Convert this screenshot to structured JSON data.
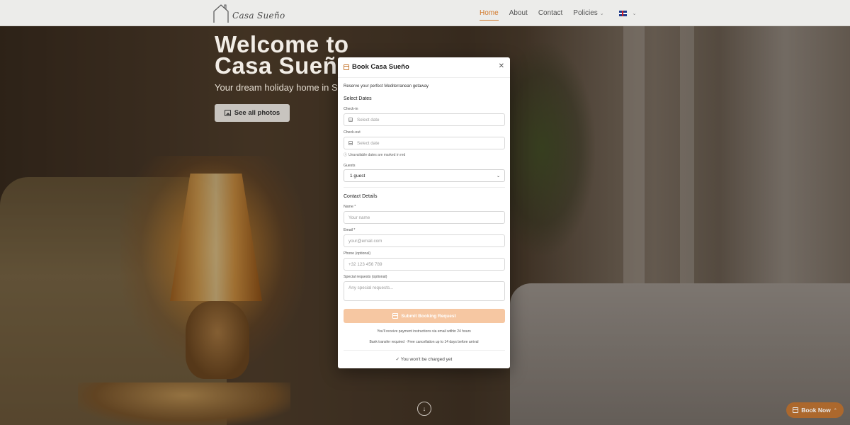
{
  "brand": {
    "logo_text": "Casa Sueño"
  },
  "nav": {
    "items": [
      {
        "label": "Home",
        "active": true
      },
      {
        "label": "About",
        "active": false
      },
      {
        "label": "Contact",
        "active": false
      },
      {
        "label": "Policies",
        "active": false
      }
    ],
    "language_icon": "uk-flag-icon",
    "accent_color": "#d27a2c"
  },
  "hero": {
    "title_line1": "Welcome to",
    "title_line2": "Casa Sueño",
    "subtitle": "Your dream holiday home in Sp",
    "photos_button": "See all photos"
  },
  "floating": {
    "book_now": "Book Now"
  },
  "modal": {
    "title": "Book Casa Sueño",
    "tagline": "Reserve your perfect Mediterranean getaway",
    "dates_section": "Select Dates",
    "checkin_label": "Check-in",
    "checkin_placeholder": "Select date",
    "checkout_label": "Check-out",
    "checkout_placeholder": "Select date",
    "unavailable_hint": "Unavailable dates are marked in red",
    "guests_label": "Guests",
    "guests_value": "1 guest",
    "contact_section": "Contact Details",
    "name_label": "Name *",
    "name_placeholder": "Your name",
    "email_label": "Email *",
    "email_placeholder": "your@email.com",
    "phone_label": "Phone (optional)",
    "phone_placeholder": "+32 123 456 789",
    "requests_label": "Special requests (optional)",
    "requests_placeholder": "Any special requests...",
    "submit_label": "Submit Booking Request",
    "note_payment": "You'll receive payment instructions via email within 24 hours",
    "note_bank": "Bank transfer required · Free cancellation up to 14 days before arrival",
    "charged_note": "✓ You won't be charged yet",
    "submit_color": "#f6c7a2"
  }
}
